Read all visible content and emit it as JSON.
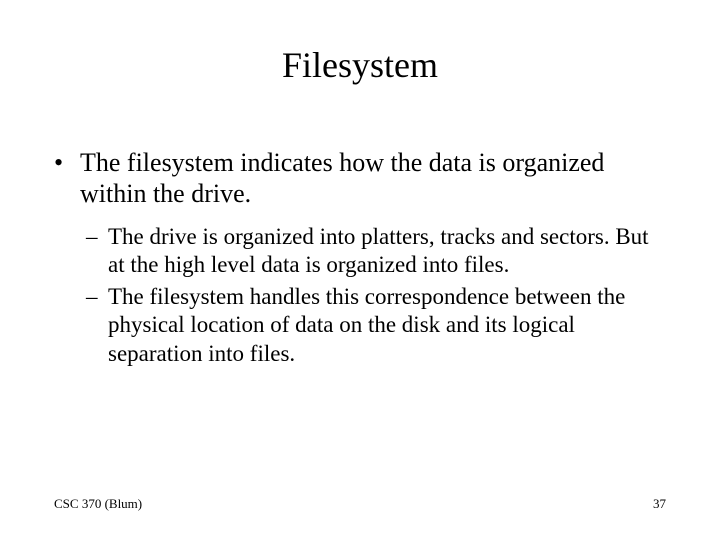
{
  "title": "Filesystem",
  "bullets": {
    "main": "The filesystem indicates how the data is organized within the drive.",
    "sub1": "The drive is organized into platters, tracks and sectors. But at the high level data is organized into files.",
    "sub2": "The filesystem handles this correspondence between the physical location of data on the disk and its logical separation into files."
  },
  "footer": {
    "left": "CSC 370 (Blum)",
    "right": "37"
  },
  "glyphs": {
    "bullet": "•",
    "dash": "–"
  }
}
